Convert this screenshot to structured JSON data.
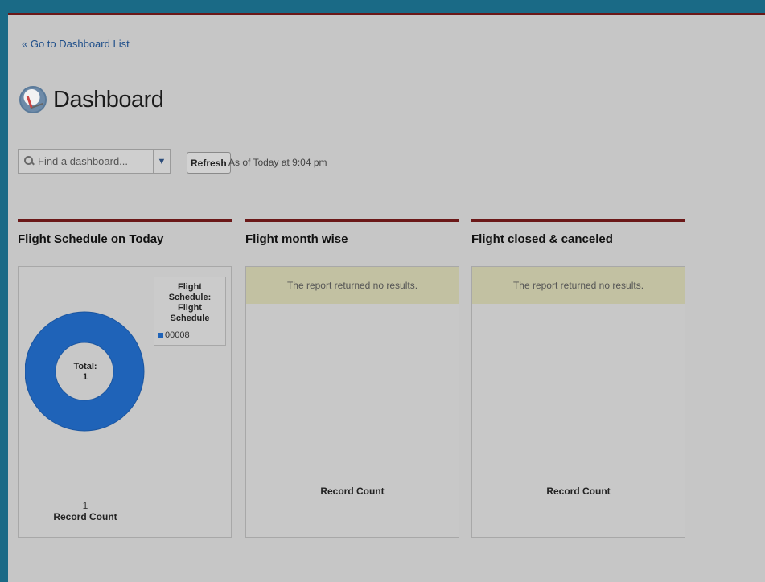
{
  "header": {
    "back_link": "« Go to Dashboard List",
    "title": "Dashboard"
  },
  "toolbar": {
    "search_placeholder": "Find a dashboard...",
    "refresh_label": "Refresh",
    "as_of": "As of Today at 9:04 pm"
  },
  "components": [
    {
      "title": "Flight Schedule on Today",
      "chart_data": {
        "type": "pie",
        "title": "Flight Schedule on Today",
        "legend_title": "Flight Schedule: Flight Schedule",
        "categories": [
          "00008"
        ],
        "values": [
          1
        ],
        "colors": [
          "#1f63b8"
        ],
        "total_label": "Total:",
        "total_value": "1",
        "value_label": "1",
        "xlabel": "Record Count",
        "legend_position": "top-right"
      }
    },
    {
      "title": "Flight month wise",
      "message": "The report returned no results.",
      "xlabel": "Record Count"
    },
    {
      "title": "Flight closed & canceled",
      "message": "The report returned no results.",
      "xlabel": "Record Count"
    }
  ],
  "colors": {
    "accent_bar": "#6b1818",
    "page_frame": "#1a6a86",
    "no_results_bg": "#c2c1a2",
    "donut": "#1f63b8"
  }
}
